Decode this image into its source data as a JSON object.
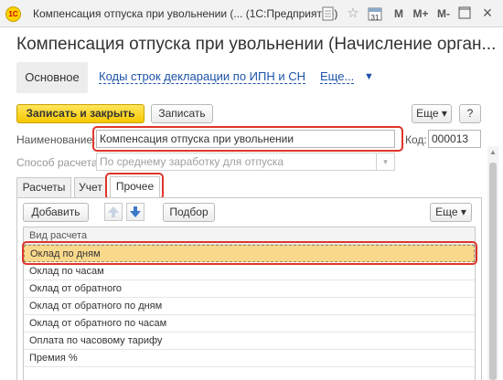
{
  "window": {
    "app_logo": "1С",
    "title": "Компенсация отпуска при увольнении (... (1С:Предприятие)",
    "calendar_day": "31",
    "icons": [
      "document-icon",
      "star-icon",
      "calendar-icon",
      "memory-plus-icon",
      "memory-minus-icon",
      "restore-icon",
      "close-icon"
    ],
    "m_label": "M",
    "m_plus_label": "M+",
    "m_minus_label": "M-",
    "close_glyph": "×"
  },
  "header": {
    "form_title": "Компенсация отпуска при увольнении (Начисление орган...",
    "nav_main": "Основное",
    "nav_link_1": "Коды строк декларации по ИПН и СН",
    "nav_more": "Еще...",
    "nav_arrow": "▼"
  },
  "toolbar": {
    "save_close": "Записать и закрыть",
    "save": "Записать",
    "more": "Еще ▾",
    "help": "?"
  },
  "fields": {
    "name_label": "Наименование:",
    "name_value": "Компенсация отпуска при увольнении",
    "code_label": "Код:",
    "code_value": "000013",
    "method_label": "Способ расчета:",
    "method_value": "По среднему заработку для отпуска",
    "dropdown_glyph": "▾"
  },
  "tabs": [
    "Расчеты",
    "Учет",
    "Прочее"
  ],
  "active_tab": 2,
  "panel_toolbar": {
    "add": "Добавить",
    "select": "Подбор",
    "more": "Еще ▾"
  },
  "grid": {
    "header": "Вид расчета",
    "rows": [
      "Оклад по дням",
      "Оклад по часам",
      "Оклад от обратного",
      "Оклад от обратного по дням",
      "Оклад от обратного по часам",
      "Оплата по часовому тарифу",
      "Премия %"
    ],
    "selected_row": 0
  },
  "colors": {
    "highlight": "#e0352b",
    "primary_button": "#f6c800",
    "link": "#1c53a8",
    "selected_row": "#fbd98c"
  }
}
